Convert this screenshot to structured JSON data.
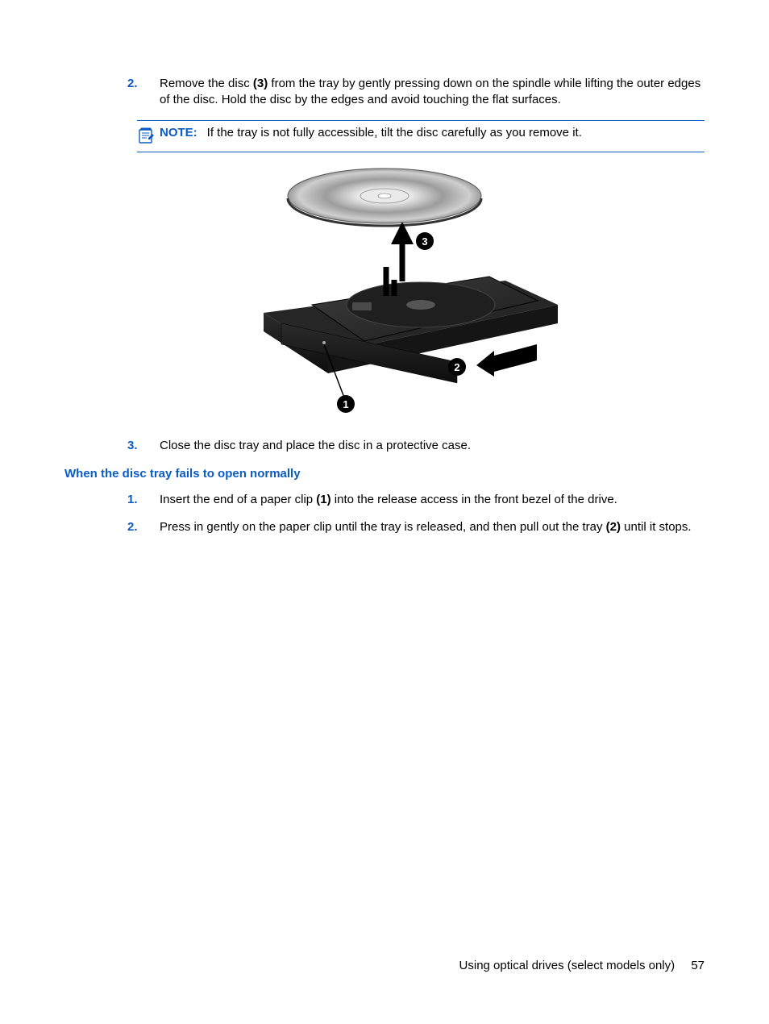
{
  "steps_a": {
    "num2": "2.",
    "text2_a": "Remove the disc ",
    "text2_b": "(3)",
    "text2_c": " from the tray by gently pressing down on the spindle while lifting the outer edges of the disc. Hold the disc by the edges and avoid touching the flat surfaces.",
    "num3": "3.",
    "text3": "Close the disc tray and place the disc in a protective case."
  },
  "note": {
    "label": "NOTE:",
    "text": "If the tray is not fully accessible, tilt the disc carefully as you remove it."
  },
  "section_heading": "When the disc tray fails to open normally",
  "steps_b": {
    "num1": "1.",
    "text1_a": "Insert the end of a paper clip ",
    "text1_b": "(1)",
    "text1_c": " into the release access in the front bezel of the drive.",
    "num2": "2.",
    "text2_a": "Press in gently on the paper clip until the tray is released, and then pull out the tray ",
    "text2_b": "(2)",
    "text2_c": " until it stops."
  },
  "diagram": {
    "callout1": "1",
    "callout2": "2",
    "callout3": "3"
  },
  "footer": {
    "section": "Using optical drives (select models only)",
    "page": "57"
  }
}
